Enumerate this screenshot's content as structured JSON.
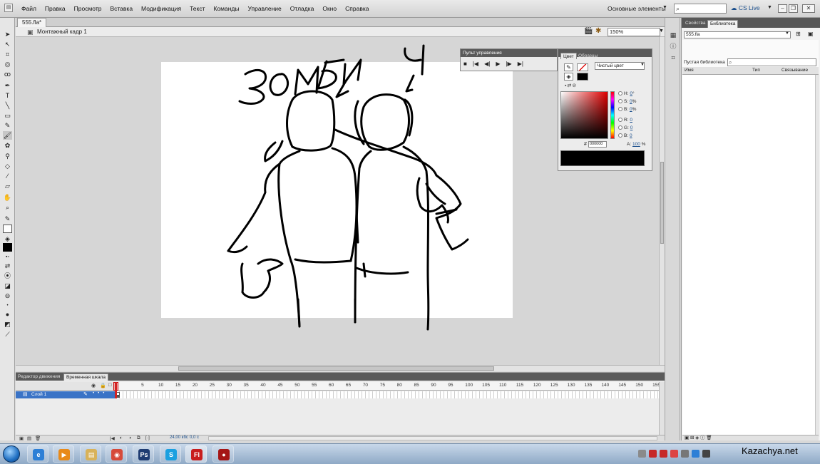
{
  "menu": {
    "items": [
      "Файл",
      "Правка",
      "Просмотр",
      "Вставка",
      "Модификация",
      "Текст",
      "Команды",
      "Управление",
      "Отладка",
      "Окно",
      "Справка"
    ],
    "workspace": "Основные элементы",
    "cs_live": "CS Live"
  },
  "document": {
    "tab_label": "555.fla*",
    "scene_label": "Монтажный кадр 1",
    "zoom": "150%"
  },
  "stage": {
    "sketch_text_left": "ЗОМБИ",
    "sketch_text_right": "Ч"
  },
  "controller": {
    "title": "Пульт управления",
    "buttons": [
      "■",
      "|◀",
      "◀|",
      "▶",
      "|▶",
      "▶|"
    ]
  },
  "color_panel": {
    "tabs": [
      "Цвет",
      "Образцы"
    ],
    "fill_type": "Чистый цвет",
    "fields": [
      {
        "label": "H:",
        "value": "0",
        "unit": "°"
      },
      {
        "label": "S:",
        "value": "0",
        "unit": "%"
      },
      {
        "label": "B:",
        "value": "0",
        "unit": "%"
      },
      {
        "label": "R:",
        "value": "0",
        "unit": ""
      },
      {
        "label": "G:",
        "value": "0",
        "unit": ""
      },
      {
        "label": "B:",
        "value": "0",
        "unit": ""
      }
    ],
    "hex_label": "#",
    "hex": "000000",
    "alpha_label": "A:",
    "alpha": "100",
    "alpha_unit": "%",
    "current_color": "#000000"
  },
  "library": {
    "tabs": [
      "Свойства",
      "Библиотека"
    ],
    "document": "555.fla",
    "item_count": "Пустая библиотека",
    "columns": [
      "Имя",
      "Тип",
      "Связывание"
    ]
  },
  "timeline": {
    "tabs": [
      "Редактор движения",
      "Временная шкала"
    ],
    "layer_name": "Слой 1",
    "frame_numbers": [
      "5",
      "10",
      "15",
      "20",
      "25",
      "30",
      "35",
      "40",
      "45",
      "50",
      "55",
      "60",
      "65",
      "70",
      "75",
      "80",
      "85",
      "90",
      "95",
      "100",
      "105",
      "110",
      "115",
      "120",
      "125",
      "130",
      "135",
      "140",
      "145",
      "150",
      "155"
    ],
    "fps": "24,00 кбс",
    "time": "0,0 с"
  },
  "taskbar": {
    "apps": [
      {
        "name": "ie",
        "glyph": "e",
        "color": "#2d7fd6"
      },
      {
        "name": "media",
        "glyph": "▶",
        "color": "#e88a1a"
      },
      {
        "name": "explorer",
        "glyph": "▤",
        "color": "#d8b25a"
      },
      {
        "name": "chrome",
        "glyph": "◉",
        "color": "#d64a3a"
      },
      {
        "name": "photoshop",
        "glyph": "Ps",
        "color": "#1f3c72"
      },
      {
        "name": "skype",
        "glyph": "S",
        "color": "#1aa0e0"
      },
      {
        "name": "flash",
        "glyph": "Fl",
        "color": "#c81e1e"
      },
      {
        "name": "recorder",
        "glyph": "●",
        "color": "#a51616"
      }
    ]
  },
  "watermark": "Kazachya.net"
}
